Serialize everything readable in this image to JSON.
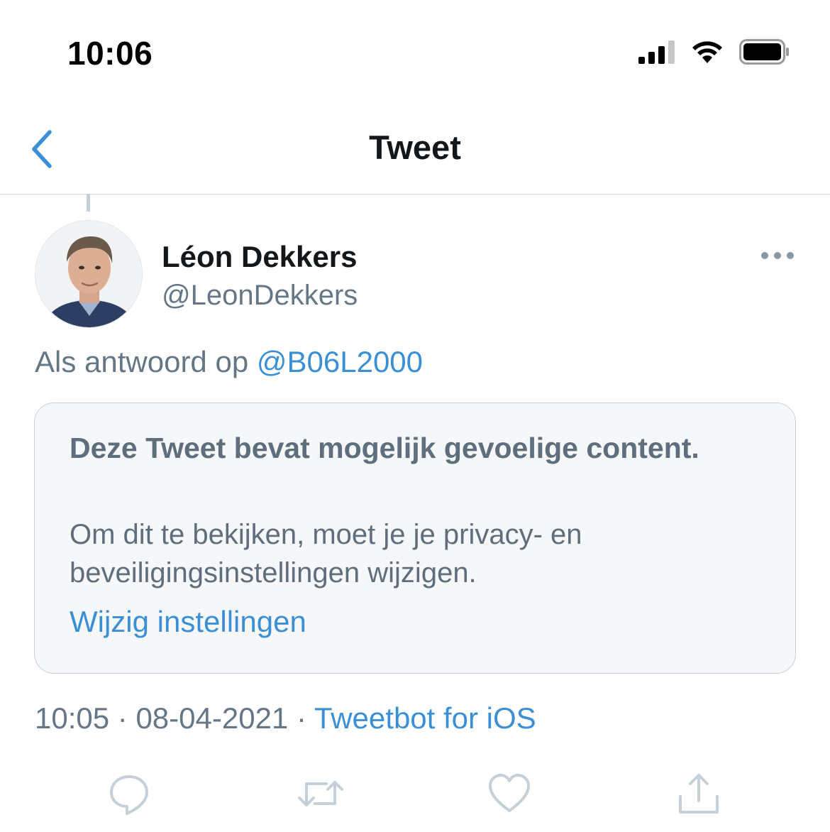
{
  "status_bar": {
    "time": "10:06"
  },
  "nav": {
    "title": "Tweet",
    "back_icon": "chevron-left-icon"
  },
  "tweet": {
    "author_name": "Léon Dekkers",
    "author_handle": "@LeonDekkers",
    "reply_prefix": "Als antwoord op",
    "reply_mention": "@B06L2000",
    "sensitive_notice": {
      "title": "Deze Tweet bevat mogelijk gevoelige content.",
      "body": "Om dit te bekijken, moet je je privacy- en beveiligingsinstellingen wijzigen.",
      "link": "Wijzig instellingen"
    },
    "time": "10:05",
    "separator": "·",
    "date": "08-04-2021",
    "source": "Tweetbot for iOS"
  },
  "actions": [
    "reply-icon",
    "retweet-icon",
    "like-icon",
    "share-icon"
  ],
  "colors": {
    "accent": "#3b8fd4",
    "muted_text": "#657786",
    "card_background": "#f5f7f9"
  }
}
